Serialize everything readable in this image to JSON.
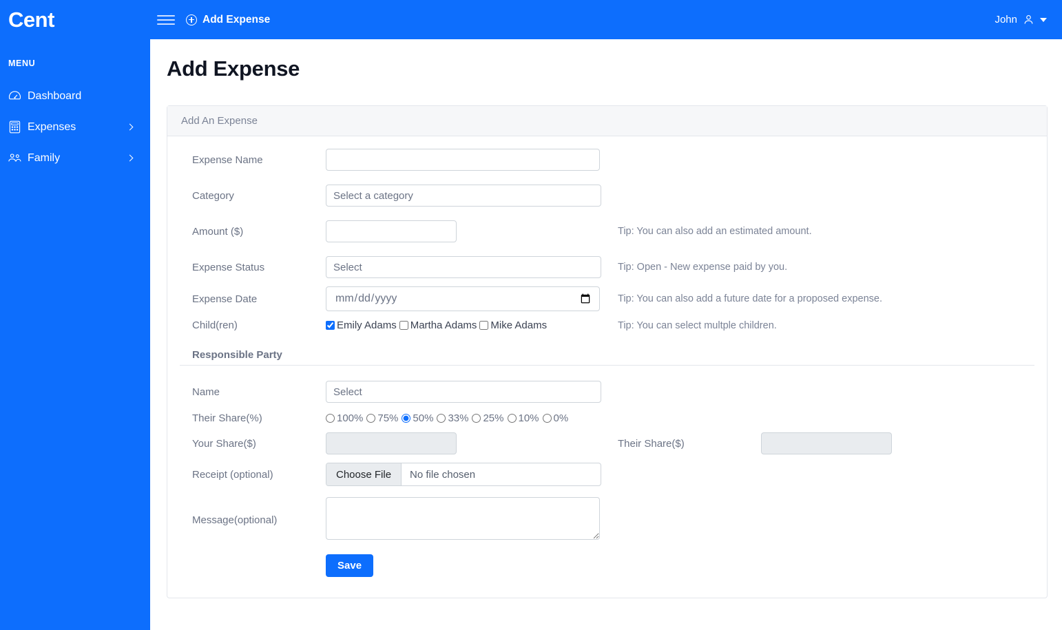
{
  "brand": {
    "logo_text": "Cent",
    "accent_color": "#0d6efd"
  },
  "topbar": {
    "menu_toggle_icon": "hamburger-icon",
    "add_expense_label": "Add Expense",
    "add_expense_icon": "plus-circle-icon",
    "user_name": "John",
    "user_icon": "person-icon",
    "caret_icon": "caret-down-icon"
  },
  "sidebar": {
    "heading": "MENU",
    "items": [
      {
        "label": "Dashboard",
        "icon": "speedometer-icon",
        "has_chevron": false
      },
      {
        "label": "Expenses",
        "icon": "calculator-icon",
        "has_chevron": true
      },
      {
        "label": "Family",
        "icon": "people-icon",
        "has_chevron": true
      }
    ]
  },
  "main": {
    "page_title": "Add Expense",
    "card_header": "Add An Expense",
    "fields": {
      "expense_name": {
        "label": "Expense Name",
        "value": "",
        "placeholder": ""
      },
      "category": {
        "label": "Category",
        "selected": "Select a category"
      },
      "amount": {
        "label": "Amount ($)",
        "value": "",
        "placeholder": "",
        "tip": "Tip: You can also add an estimated amount."
      },
      "status": {
        "label": "Expense Status",
        "selected": "Select",
        "tip": "Tip: Open - New expense paid by you."
      },
      "date": {
        "label": "Expense Date",
        "placeholder": "mm/dd/yyyy",
        "value": "",
        "tip": "Tip: You can also add a future date for a proposed expense.",
        "icon": "calendar-icon"
      },
      "children": {
        "label": "Child(ren)",
        "tip": "Tip: You can select multple children.",
        "options": [
          {
            "label": "Emily Adams",
            "checked": true
          },
          {
            "label": "Martha Adams",
            "checked": false
          },
          {
            "label": "Mike Adams",
            "checked": false
          }
        ]
      }
    },
    "responsible_party": {
      "heading": "Responsible Party",
      "name": {
        "label": "Name",
        "selected": "Select"
      },
      "their_share_pct": {
        "label": "Their Share(%)",
        "options": [
          "100%",
          "75%",
          "50%",
          "33%",
          "25%",
          "10%",
          "0%"
        ],
        "selected": "50%"
      },
      "your_share": {
        "label": "Your Share($)",
        "value": "",
        "disabled": true
      },
      "their_share": {
        "label": "Their Share($)",
        "value": "",
        "disabled": true
      },
      "receipt": {
        "label": "Receipt (optional)",
        "button_label": "Choose File",
        "file_status": "No file chosen"
      },
      "message": {
        "label": "Message(optional)",
        "value": "",
        "placeholder": ""
      },
      "save_label": "Save"
    }
  }
}
